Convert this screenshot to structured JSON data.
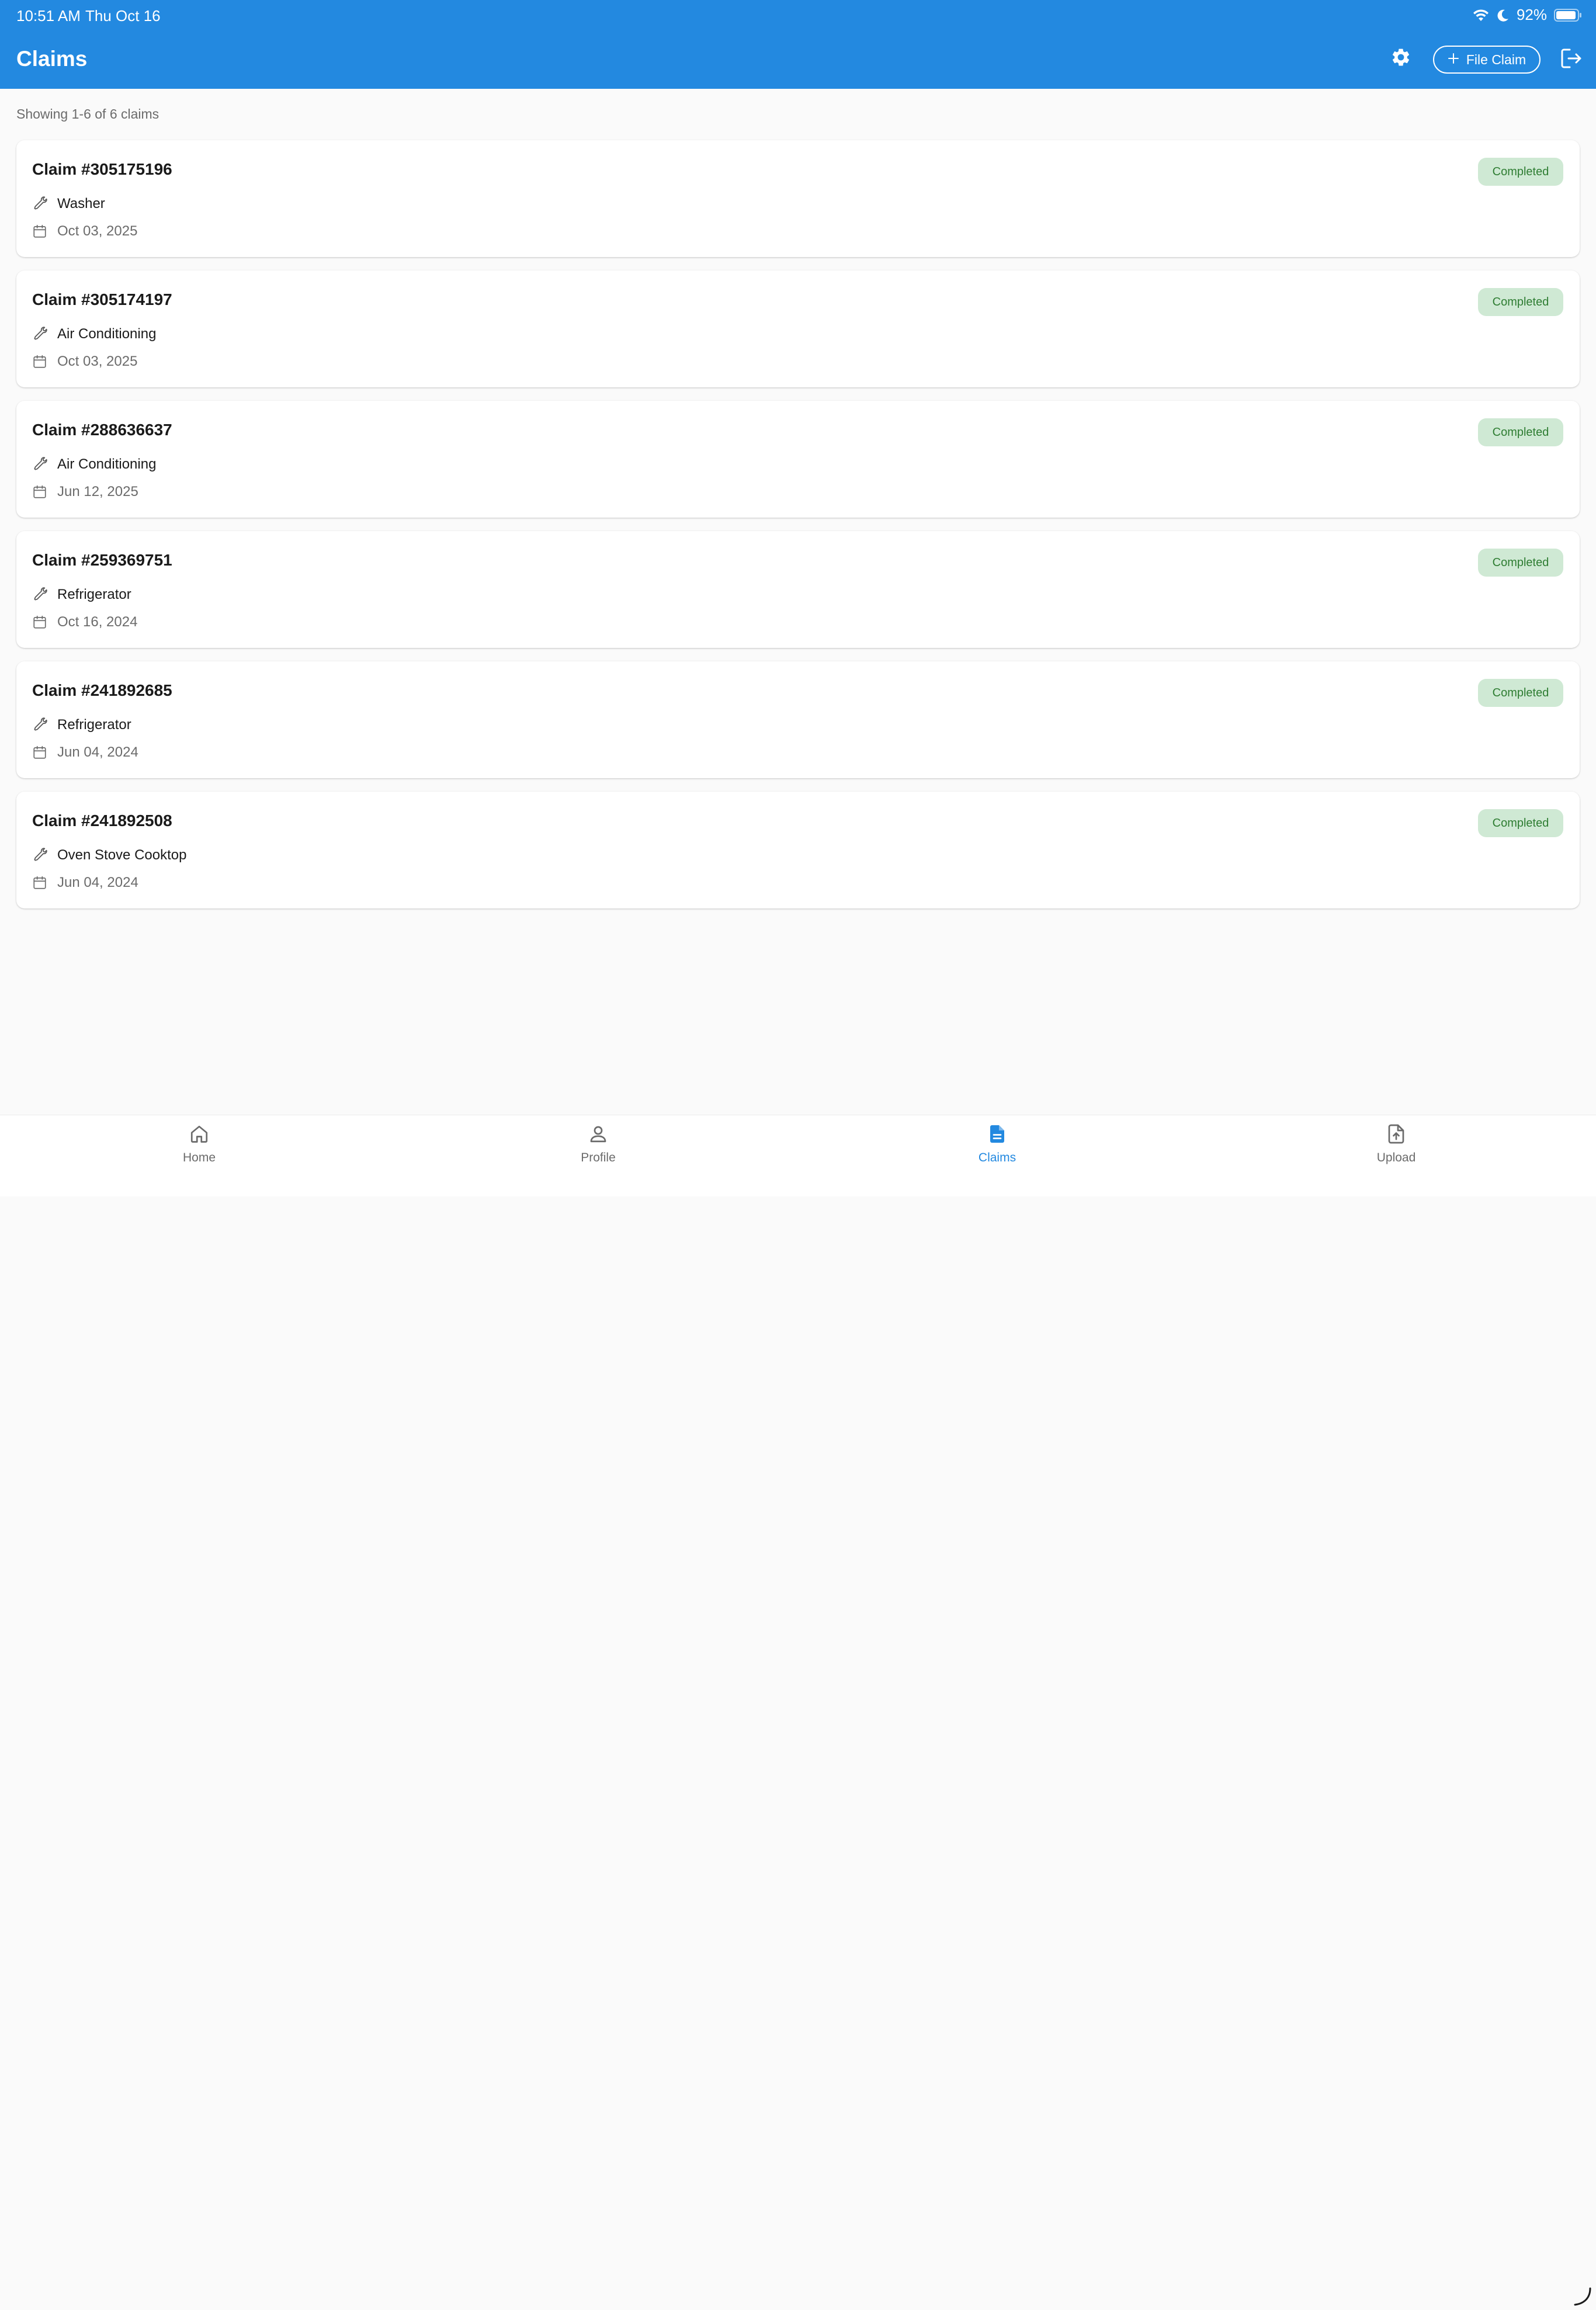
{
  "status_bar": {
    "time": "10:51 AM",
    "date": "Thu Oct 16",
    "battery": "92%",
    "icons": [
      "wifi-icon",
      "moon-icon",
      "battery-icon"
    ]
  },
  "app_bar": {
    "title": "Claims",
    "settings_icon": "gear-icon",
    "file_claim_label": "File Claim",
    "logout_icon": "logout-icon"
  },
  "summary": "Showing 1-6 of 6 claims",
  "claims": [
    {
      "title": "Claim #305175196",
      "appliance": "Washer",
      "date": "Oct 03, 2025",
      "status": "Completed"
    },
    {
      "title": "Claim #305174197",
      "appliance": "Air Conditioning",
      "date": "Oct 03, 2025",
      "status": "Completed"
    },
    {
      "title": "Claim #288636637",
      "appliance": "Air Conditioning",
      "date": "Jun 12, 2025",
      "status": "Completed"
    },
    {
      "title": "Claim #259369751",
      "appliance": "Refrigerator",
      "date": "Oct 16, 2024",
      "status": "Completed"
    },
    {
      "title": "Claim #241892685",
      "appliance": "Refrigerator",
      "date": "Jun 04, 2024",
      "status": "Completed"
    },
    {
      "title": "Claim #241892508",
      "appliance": "Oven Stove Cooktop",
      "date": "Jun 04, 2024",
      "status": "Completed"
    }
  ],
  "bottom_nav": [
    {
      "label": "Home",
      "icon": "home-icon"
    },
    {
      "label": "Profile",
      "icon": "person-icon"
    },
    {
      "label": "Claims",
      "icon": "document-icon",
      "active": true
    },
    {
      "label": "Upload",
      "icon": "upload-file-icon"
    }
  ],
  "colors": {
    "primary": "#2389e0",
    "background": "#fafafa",
    "badge_bg": "#cfe9d4",
    "badge_text": "#2e7d32"
  }
}
